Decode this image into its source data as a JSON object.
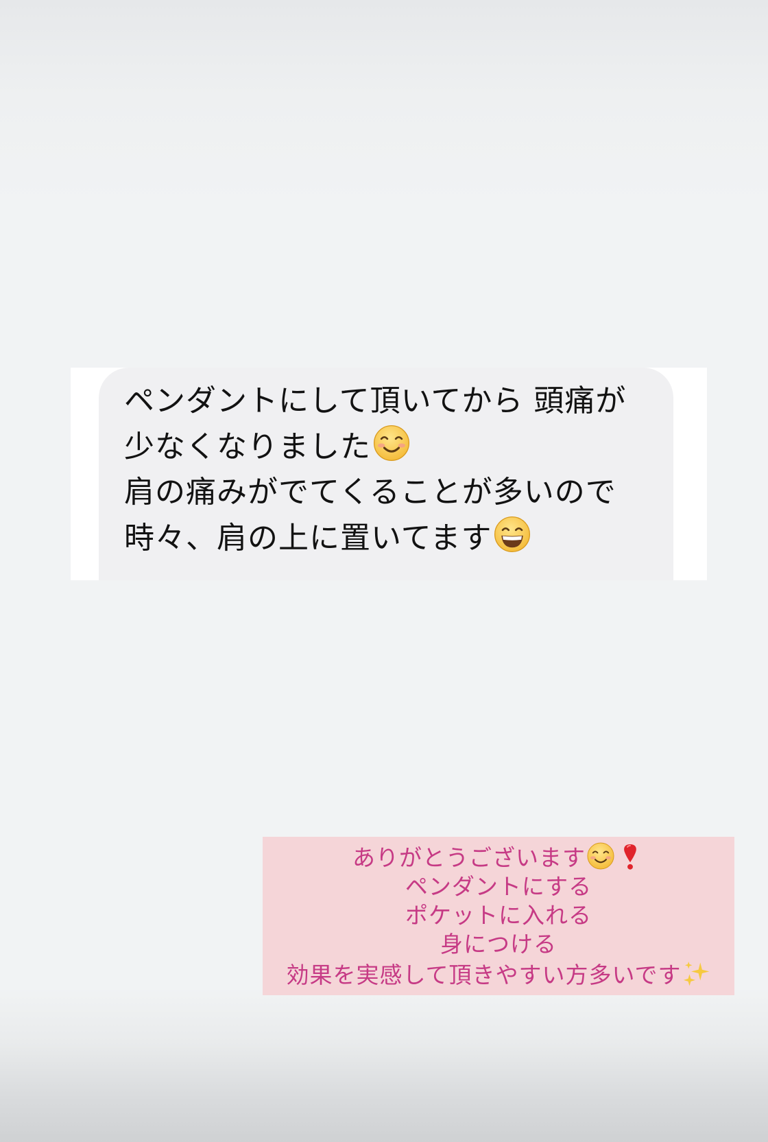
{
  "colors": {
    "background": "#f1f3f4",
    "quote_panel": "#ffffff",
    "quote_bubble": "#f0f0f2",
    "quote_text": "#121212",
    "reply_background": "#f5d5d8",
    "reply_text": "#c63a85"
  },
  "quoted_message": {
    "lines": [
      "ペンダントにして頂いてから 頭痛が",
      "少なくなりました",
      "肩の痛みがでてくることが多いので",
      "時々、肩の上に置いてます"
    ],
    "emoji_line_2": "smiling-face-icon",
    "emoji_line_4": "grinning-face-icon"
  },
  "reply": {
    "lines": [
      "ありがとうございます",
      "ペンダントにする",
      "ポケットに入れる",
      "身につける",
      "効果を実感して頂きやすい方多いです"
    ],
    "emoji_line_1": [
      "smiling-face-icon",
      "red-exclamation-icon"
    ],
    "emoji_line_5": "sparkles-icon"
  }
}
